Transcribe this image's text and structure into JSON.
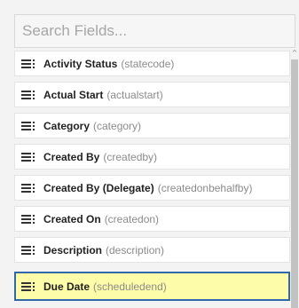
{
  "search": {
    "placeholder": "Search Fields..."
  },
  "fields": [
    {
      "label": "Activity Status",
      "logical": "(statecode)",
      "selected": false
    },
    {
      "label": "Actual Start",
      "logical": "(actualstart)",
      "selected": false
    },
    {
      "label": "Category",
      "logical": "(category)",
      "selected": false
    },
    {
      "label": "Created By",
      "logical": "(createdby)",
      "selected": false
    },
    {
      "label": "Created By (Delegate)",
      "logical": "(createdonbehalfby)",
      "selected": false
    },
    {
      "label": "Created On",
      "logical": "(createdon)",
      "selected": false
    },
    {
      "label": "Description",
      "logical": "(description)",
      "selected": false
    },
    {
      "label": "Due Date",
      "logical": "(scheduledend)",
      "selected": true
    }
  ],
  "icons": {
    "drag_handle": "drag-handle-icon",
    "scroll_up": "scroll-up-arrow-icon"
  },
  "colors": {
    "selected_bg": "#fdfca8",
    "selected_border": "#2f69a9"
  },
  "scroll": {
    "up_arrow": "^"
  }
}
